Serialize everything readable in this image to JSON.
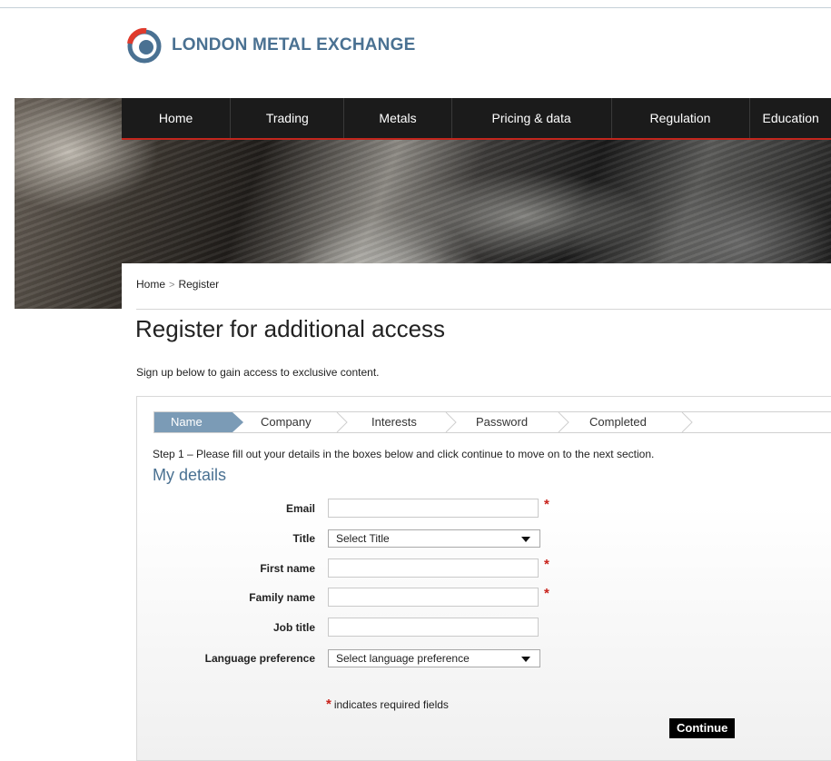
{
  "brand": {
    "name": "LONDON METAL EXCHANGE",
    "color": "#4a7192",
    "accent": "#e03a2c"
  },
  "nav": {
    "items": [
      {
        "label": "Home"
      },
      {
        "label": "Trading"
      },
      {
        "label": "Metals"
      },
      {
        "label": "Pricing & data"
      },
      {
        "label": "Regulation"
      },
      {
        "label": "Education"
      }
    ]
  },
  "breadcrumb": {
    "items": [
      "Home",
      "Register"
    ],
    "separator": ">"
  },
  "page": {
    "title": "Register for additional access",
    "intro": "Sign up below to gain access to exclusive content."
  },
  "steps": [
    {
      "label": "Name",
      "active": true
    },
    {
      "label": "Company",
      "active": false
    },
    {
      "label": "Interests",
      "active": false
    },
    {
      "label": "Password",
      "active": false
    },
    {
      "label": "Completed",
      "active": false
    }
  ],
  "form": {
    "instruction": "Step 1 – Please fill out your details in the boxes below and click continue to move on to the next section.",
    "section_title": "My details",
    "fields": {
      "email": {
        "label": "Email",
        "value": "",
        "required": true
      },
      "title": {
        "label": "Title",
        "selected": "Select Title"
      },
      "first_name": {
        "label": "First name",
        "value": "",
        "required": true
      },
      "family_name": {
        "label": "Family name",
        "value": "",
        "required": true
      },
      "job_title": {
        "label": "Job title",
        "value": ""
      },
      "language": {
        "label": "Language preference",
        "selected": "Select language preference"
      }
    },
    "required_marker": "*",
    "required_note": "indicates required fields",
    "continue_label": "Continue"
  }
}
